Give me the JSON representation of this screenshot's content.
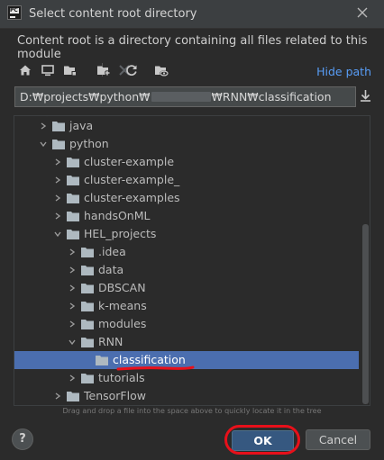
{
  "window": {
    "title": "Select content root directory",
    "app_icon_text": "PC"
  },
  "description": "Content root is a directory containing all files related to this module",
  "toolbar": {
    "icons": [
      "home-icon",
      "desktop-icon",
      "project-folder-icon",
      "new-folder-icon",
      "delete-icon",
      "refresh-icon",
      "show-hidden-icon"
    ],
    "hide_path_label": "Hide path"
  },
  "path": {
    "before": "D:₩projects₩python₩",
    "redacted": "",
    "after": "₩RNN₩classification"
  },
  "tree": {
    "rows": [
      {
        "label": "java",
        "expanded": false
      },
      {
        "label": "python",
        "expanded": true
      },
      {
        "label": "cluster-example",
        "expanded": false
      },
      {
        "label": "cluster-example_",
        "expanded": false
      },
      {
        "label": "cluster-examples",
        "expanded": false
      },
      {
        "label": "handsOnML",
        "expanded": false
      },
      {
        "label": "HEL_projects",
        "expanded": true
      },
      {
        "label": ".idea",
        "expanded": false
      },
      {
        "label": "data",
        "expanded": false
      },
      {
        "label": "DBSCAN",
        "expanded": false
      },
      {
        "label": "k-means",
        "expanded": false
      },
      {
        "label": "modules",
        "expanded": false
      },
      {
        "label": "RNN",
        "expanded": true
      },
      {
        "label": "classification",
        "expanded": false,
        "selected": true
      },
      {
        "label": "tutorials",
        "expanded": false
      },
      {
        "label": "TensorFlow",
        "expanded": false
      }
    ]
  },
  "hint": "Drag and drop a file into the space above to quickly locate it in the tree",
  "buttons": {
    "help": "?",
    "ok": "OK",
    "cancel": "Cancel"
  },
  "colors": {
    "background": "#2b2b2b",
    "selection": "#4b6eaf",
    "link": "#589df6",
    "ok_button": "#365880",
    "annotation": "#e8101a",
    "folder": "#aeb9c0"
  }
}
